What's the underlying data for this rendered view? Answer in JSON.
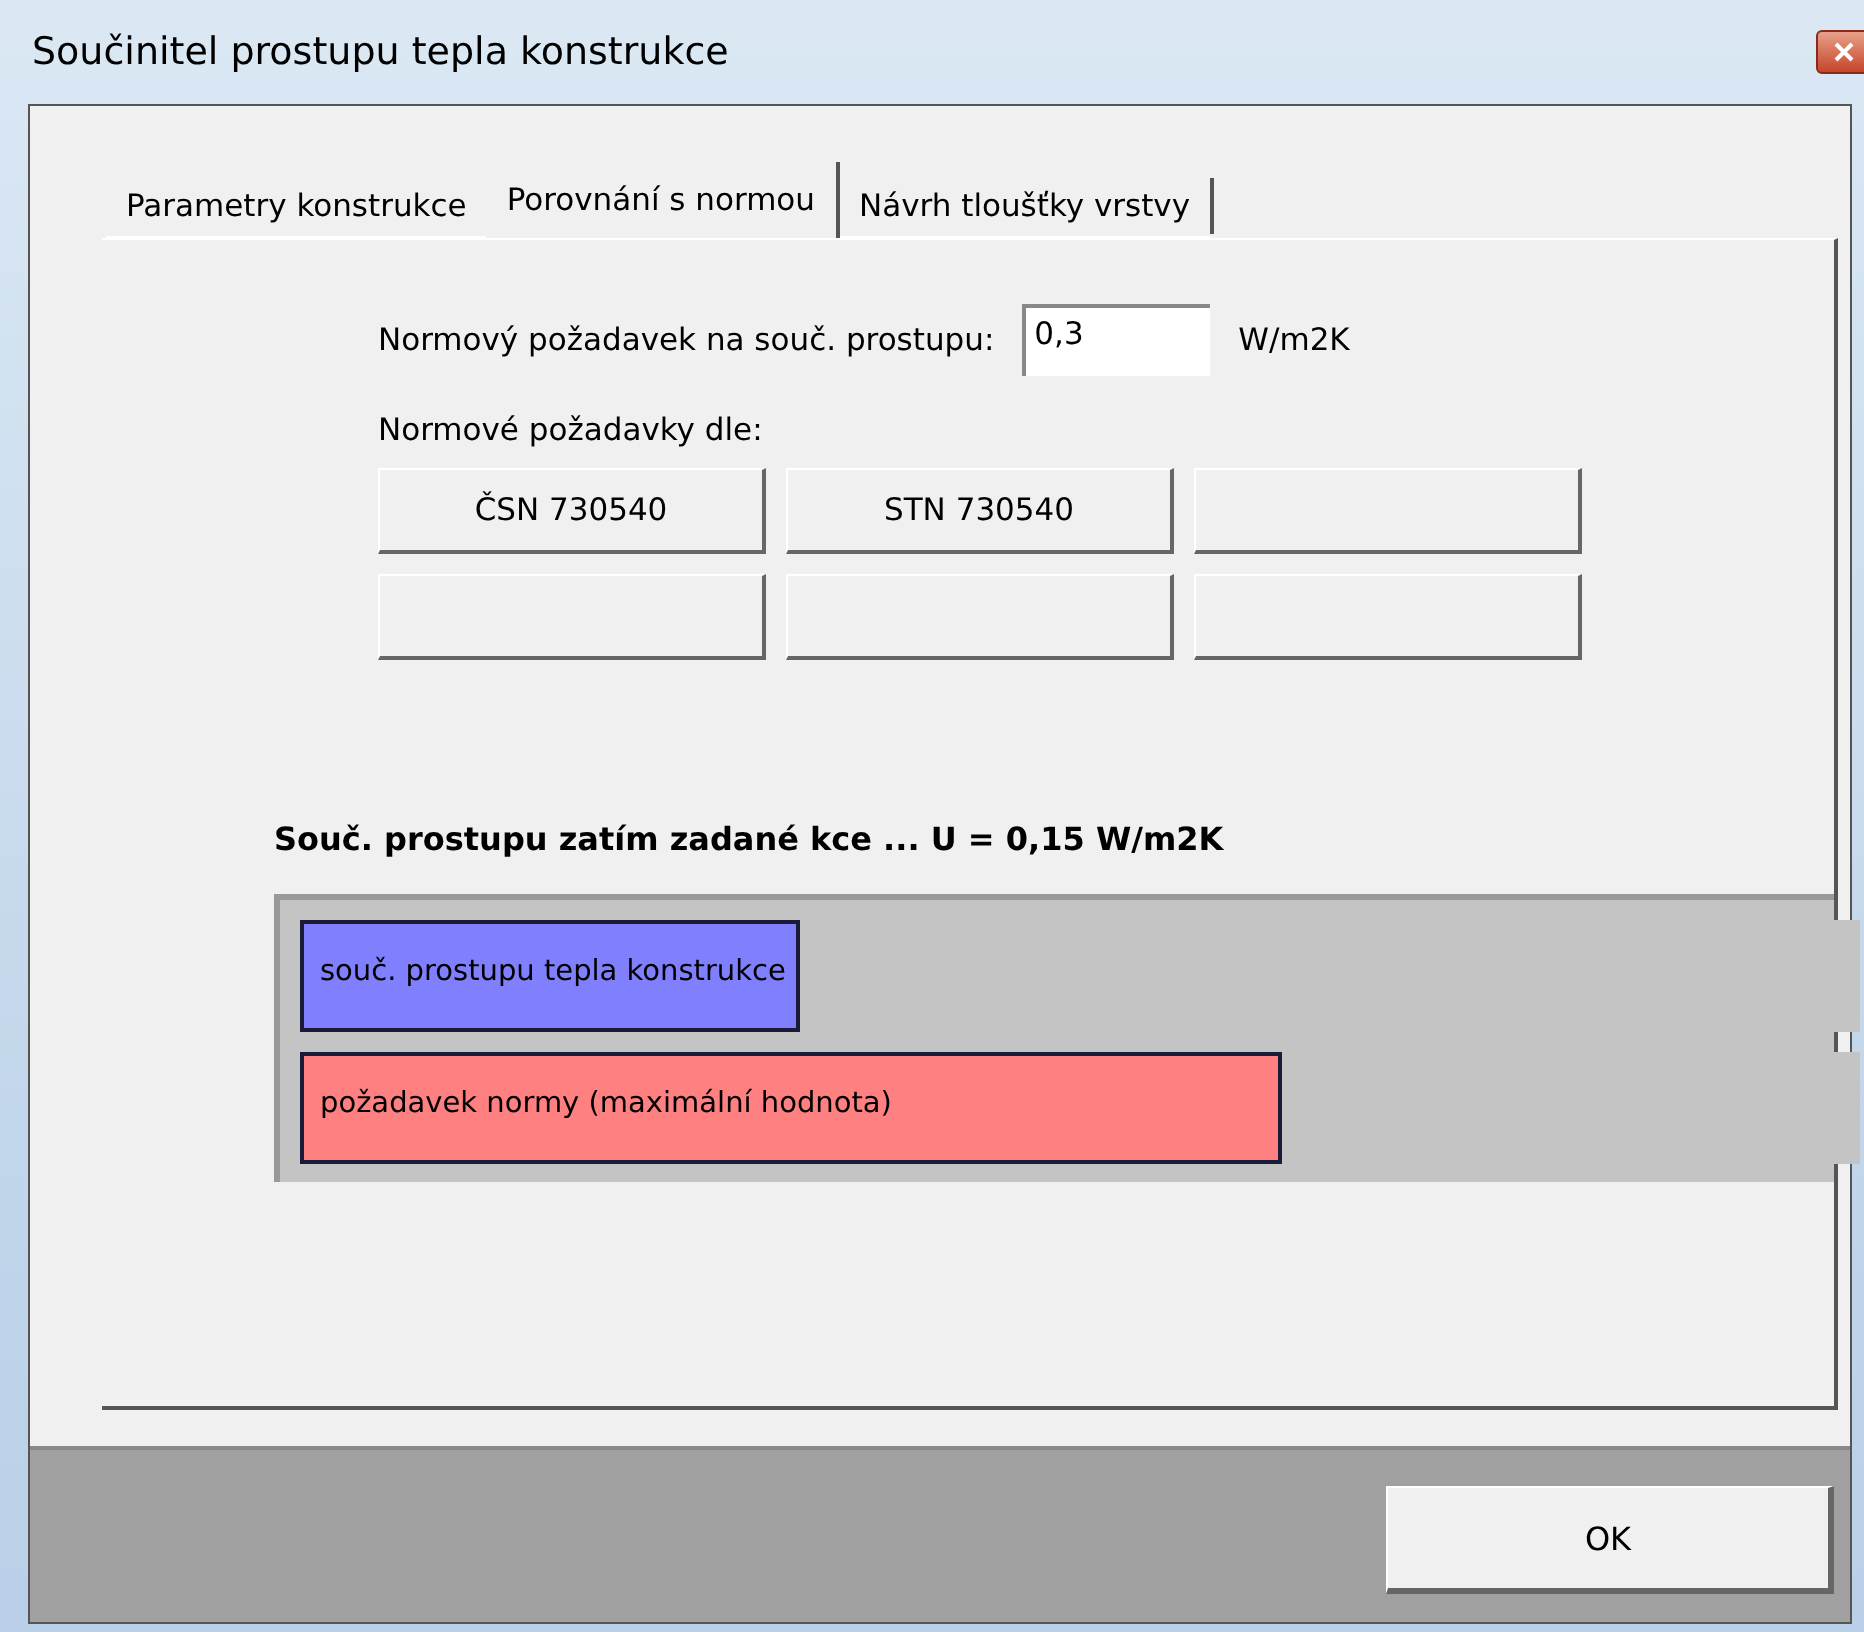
{
  "window": {
    "title": "Součinitel prostupu tepla konstrukce"
  },
  "tabs": [
    {
      "label": "Parametry konstrukce",
      "selected": false
    },
    {
      "label": "Porovnání s normou",
      "selected": true
    },
    {
      "label": "Návrh tloušťky vrstvy",
      "selected": false
    }
  ],
  "requirement": {
    "label": "Normový požadavek na souč. prostupu:",
    "value": "0,3",
    "unit": "W/m2K"
  },
  "norms": {
    "label": "Normové požadavky dle:",
    "buttons": [
      "ČSN 730540",
      "STN 730540"
    ]
  },
  "result": {
    "heading": "Souč. prostupu zatím zadané kce ... U = 0,15 W/m2K"
  },
  "bars": [
    {
      "label": "souč. prostupu tepla konstrukce",
      "level": 0.32,
      "color": "#8080ff"
    },
    {
      "label": "požadavek normy (maximální hodnota)",
      "level": 0.63,
      "color": "#ff8080"
    }
  ],
  "buttons": [
    "OK"
  ]
}
